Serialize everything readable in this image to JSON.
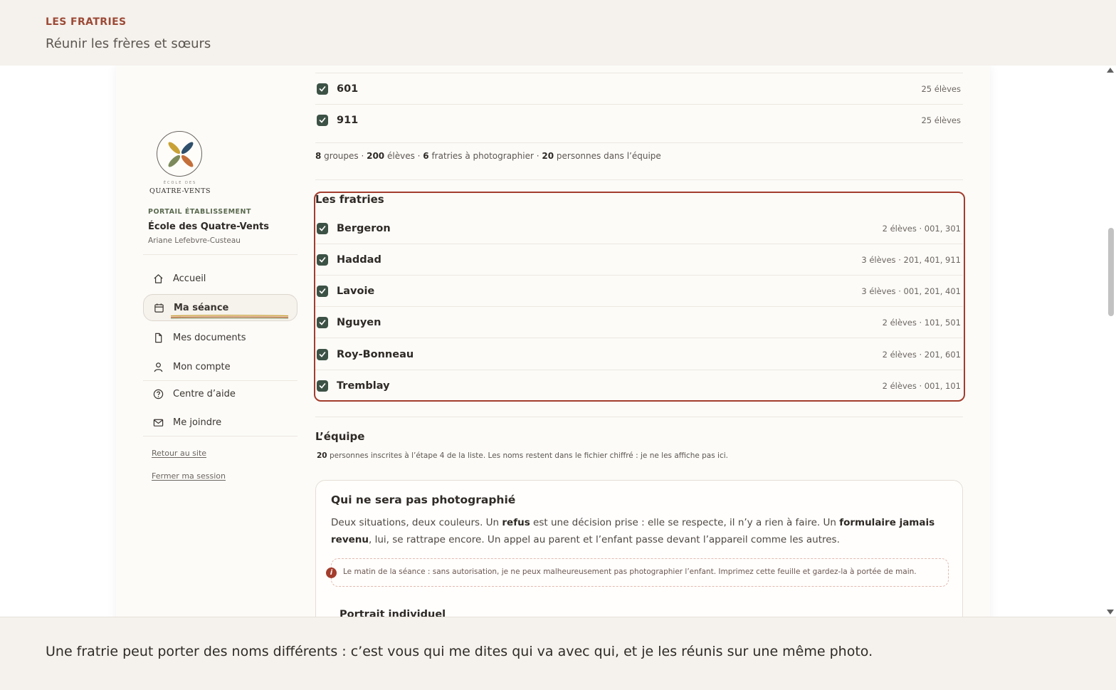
{
  "header": {
    "kicker": "LES FRATRIES",
    "subtitle": "Réunir les frères et sœurs"
  },
  "sidebar": {
    "logo_small": "ÉCOLE DES",
    "logo_name": "QUATRE-VENTS",
    "portal_kicker": "PORTAIL ÉTABLISSEMENT",
    "school": "École des Quatre-Vents",
    "user": "Ariane Lefebvre-Custeau",
    "nav": [
      {
        "label": "Accueil",
        "icon": "home-icon"
      },
      {
        "label": "Ma séance",
        "icon": "calendar-icon"
      },
      {
        "label": "Mes documents",
        "icon": "document-icon"
      },
      {
        "label": "Mon compte",
        "icon": "user-icon"
      },
      {
        "label": "Centre d’aide",
        "icon": "help-icon"
      },
      {
        "label": "Me joindre",
        "icon": "mail-icon"
      }
    ],
    "links": [
      "Retour au site",
      "Fermer ma session"
    ]
  },
  "groups": {
    "rows": [
      {
        "label": "601",
        "meta": "25 élèves",
        "checked": true
      },
      {
        "label": "911",
        "meta": "25 élèves",
        "checked": true
      }
    ],
    "stats": {
      "groups_n": "8",
      "groups_t": " groupes · ",
      "students_n": "200",
      "students_t": " élèves · ",
      "siblings_n": "6",
      "siblings_t": " fratries à photographier · ",
      "team_n": "20",
      "team_t": " personnes dans l’équipe"
    }
  },
  "fratries": {
    "title": "Les fratries",
    "rows": [
      {
        "label": "Bergeron",
        "meta": "2 élèves · 001, 301",
        "checked": true
      },
      {
        "label": "Haddad",
        "meta": "3 élèves · 201, 401, 911",
        "checked": true
      },
      {
        "label": "Lavoie",
        "meta": "3 élèves · 001, 201, 401",
        "checked": true
      },
      {
        "label": "Nguyen",
        "meta": "2 élèves · 101, 501",
        "checked": true
      },
      {
        "label": "Roy-Bonneau",
        "meta": "2 élèves · 201, 601",
        "checked": true
      },
      {
        "label": "Tremblay",
        "meta": "2 élèves · 001, 101",
        "checked": true
      }
    ]
  },
  "equipe": {
    "title": "L’équipe",
    "count": "20",
    "note": " personnes inscrites à l’étape 4 de la liste. Les noms restent dans le fichier chiffré : je ne les affiche pas ici."
  },
  "not_photographed": {
    "title": "Qui ne sera pas photographié",
    "p1": "Deux situations, deux couleurs. Un ",
    "b1": "refus",
    "p2": " est une décision prise : elle se respecte, il n’y a rien à faire. Un ",
    "b2": "formulaire jamais revenu",
    "p3": ", lui, se rattrape encore. Un appel au parent et l’enfant passe devant l’appareil comme les autres.",
    "warning": "Le matin de la séance : sans autorisation, je ne peux malheureusement pas photographier l’enfant. Imprimez cette feuille et gardez-la à portée de main.",
    "warning_icon": "i",
    "next_title": "Portrait individuel"
  },
  "footer": {
    "caption": "Une fratrie peut porter des noms différents : c’est vous qui me dites qui va avec qui, et je les réunis sur une même photo."
  },
  "colors": {
    "accent": "#a33d2d",
    "checkbox": "#3d5246",
    "band": "#f5f1ec"
  }
}
